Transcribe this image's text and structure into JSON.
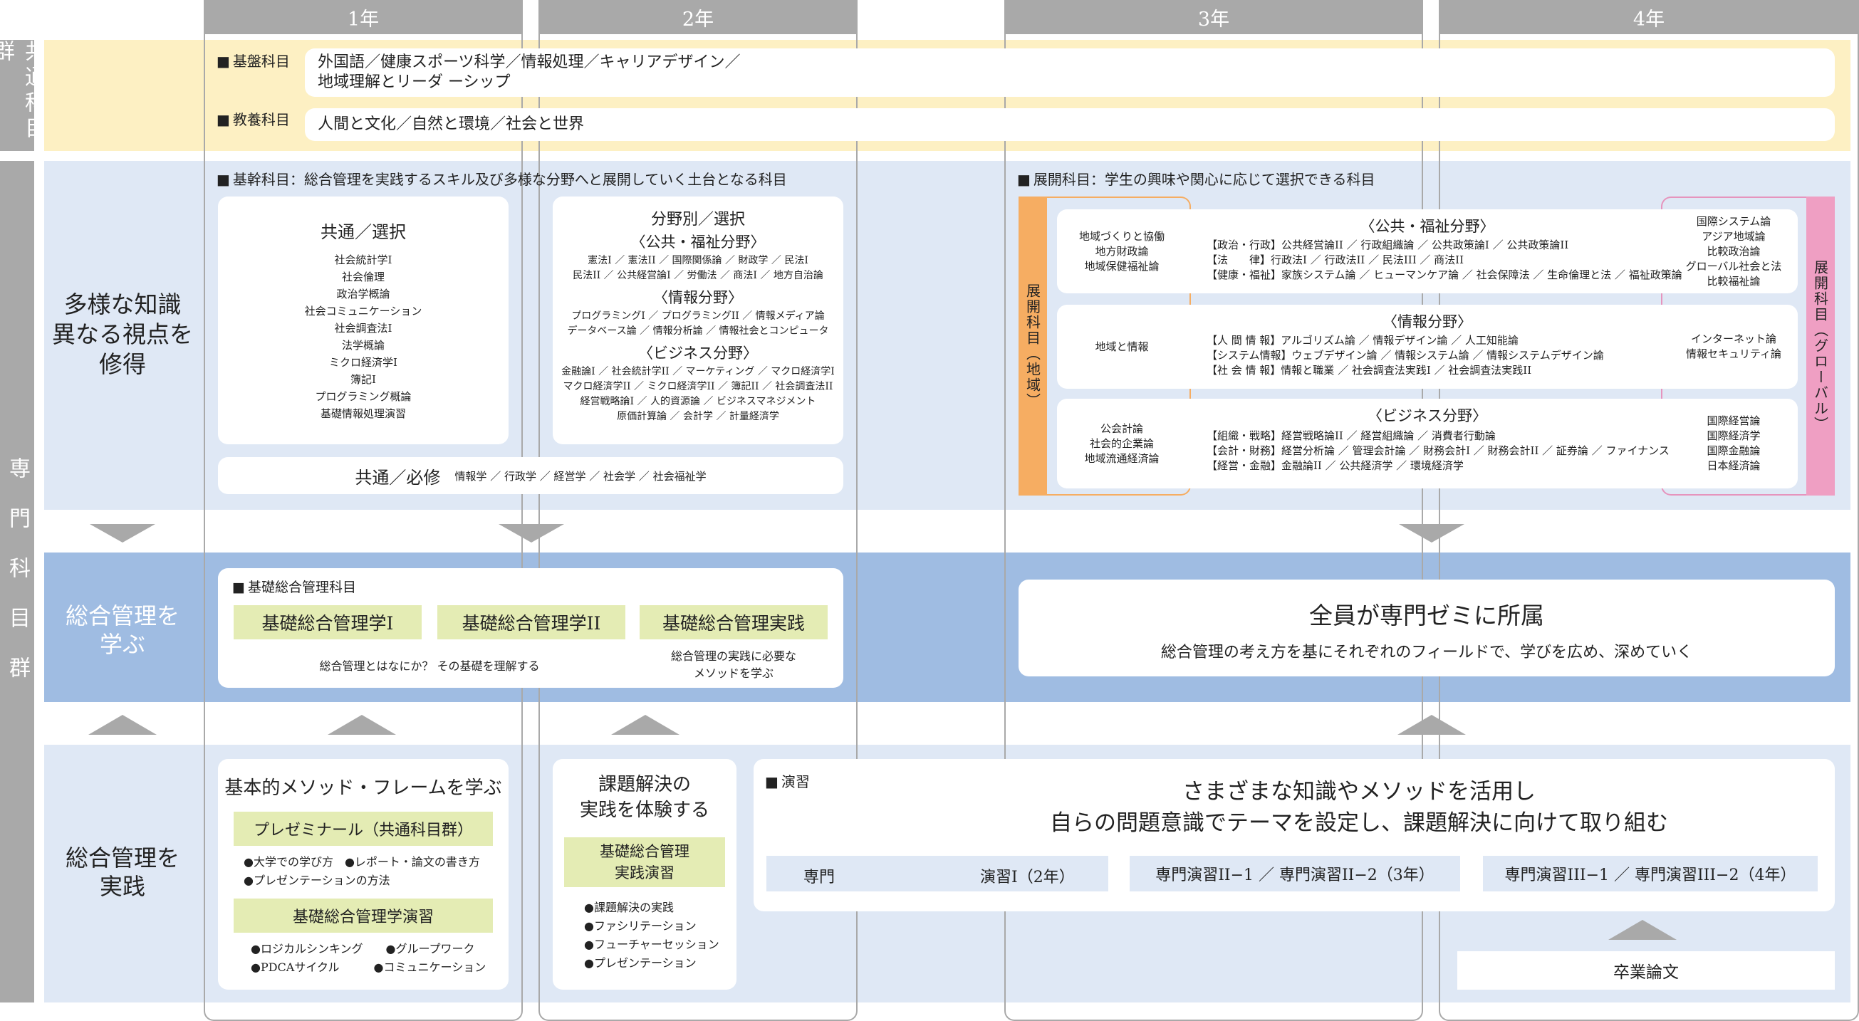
{
  "years": [
    "1年",
    "2年",
    "3年",
    "4年"
  ],
  "common_group": {
    "side_label": "共通科目群",
    "kiban_label": "基盤科目",
    "kiban_text": "外国語／健康スポーツ科学／情報処理／キャリアデザイン／\n地域理解とリーダ ーシップ",
    "kyoyo_label": "教養科目",
    "kyoyo_text": "人間と文化／自然と環境／社会と世界"
  },
  "specialized_group": {
    "side_label": "専門科目群"
  },
  "row1": {
    "title": "多様な知識\n異なる視点を\n修得",
    "kikan_header": "基幹科目：総合管理を実践するスキル及び多様な分野へと展開していく土台となる科目",
    "common_select": {
      "title": "共通／選択",
      "items": "社会統計学I\n社会倫理\n政治学概論\n社会コミュニケーション\n社会調査法I\n法学概論\nミクロ経済学I\n簿記I\nプログラミング概論\n基礎情報処理演習"
    },
    "field_select": {
      "title": "分野別／選択",
      "public_title": "〈公共・福祉分野〉",
      "public_items": "憲法I ／ 憲法II ／ 国際関係論 ／ 財政学 ／ 民法I\n民法II ／ 公共経営論I ／ 労働法 ／ 商法I ／ 地方自治論",
      "info_title": "〈情報分野〉",
      "info_items": "プログラミングI ／ プログラミングII ／ 情報メディア論\nデータベース論 ／ 情報分析論 ／ 情報社会とコンピュータ",
      "biz_title": "〈ビジネス分野〉",
      "biz_items": "金融論I ／ 社会統計学II ／ マーケティング ／ マクロ経済学I\nマクロ経済学II ／ ミクロ経済学II ／ 簿記II ／ 社会調査法II\n経営戦略論I ／ 人的資源論 ／ ビジネスマネジメント\n原価計算論 ／ 会計学 ／ 計量経済学"
    },
    "common_required": {
      "title": "共通／必修",
      "items": "情報学 ／ 行政学 ／ 経営学 ／ 社会学 ／ 社会福祉学"
    },
    "tenkai_header": "展開科目：学生の興味や関心に応じて選択できる科目",
    "regional_label": "展開科目（地域）",
    "global_label": "展開科目（グローバル）",
    "regional_items": [
      "地域づくりと協働\n地方財政論\n地域保健福祉論",
      "地域と情報",
      "公会計論\n社会的企業論\n地域流通経済論"
    ],
    "global_items": [
      "国際システム論\nアジア地域論\n比較政治論\nグローバル社会と法\n比較福祉論",
      "インターネット論\n情報セキュリティ論",
      "国際経営論\n国際経済学\n国際金融論\n日本経済論"
    ],
    "fields": [
      {
        "title": "〈公共・福祉分野〉",
        "rows": "【政治・行政】公共経営論II ／ 行政組織論 ／ 公共政策論I ／ 公共政策論II\n【法　　律】行政法I ／ 行政法II ／ 民法III ／ 商法II\n【健康・福祉】家族システム論 ／ ヒューマンケア論 ／ 社会保障法 ／ 生命倫理と法 ／ 福祉政策論"
      },
      {
        "title": "〈情報分野〉",
        "rows": "【人 間 情 報】アルゴリズム論 ／ 情報デザイン論 ／ 人工知能論\n【システム情報】ウェブデザイン論 ／ 情報システム論 ／ 情報システムデザイン論\n【社 会 情 報】情報と職業 ／ 社会調査法実践I ／ 社会調査法実践II"
      },
      {
        "title": "〈ビジネス分野〉",
        "rows": "【組織・戦略】経営戦略論II ／ 経営組織論 ／ 消費者行動論\n【会計・財務】経営分析論 ／ 管理会計論 ／ 財務会計I ／ 財務会計II ／ 証券論 ／ ファイナンス\n【経営・金融】金融論II ／ 公共経済学 ／ 環境経済学"
      }
    ]
  },
  "row2": {
    "title": "総合管理を\n学ぶ",
    "header": "基礎総合管理科目",
    "course1": "基礎総合管理学I",
    "course2": "基礎総合管理学II",
    "course3": "基礎総合管理実践",
    "desc1": "総合管理とはなにか？ その基礎を理解する",
    "desc2": "総合管理の実践に必要な\nメソッドを学ぶ",
    "seminar_title": "全員が専門ゼミに所属",
    "seminar_sub": "総合管理の考え方を基にそれぞれのフィールドで、学びを広め、深めていく"
  },
  "row3": {
    "title": "総合管理を\n実践",
    "box1_title": "基本的メソッド・フレームを学ぶ",
    "prezemi": "プレゼミナール（共通科目群）",
    "prezemi_items": "●大学での学び方　●レポート・論文の書き方\n●プレゼンテーションの方法",
    "kiso_enshu": "基礎総合管理学演習",
    "kiso_enshu_items": "●ロジカルシンキング　　●グループワーク\n●PDCAサイクル　　　●コミュニケーション",
    "box2_title": "課題解決の\n実践を体験する",
    "box2_course": "基礎総合管理\n実践演習",
    "box2_items": "●課題解決の実践\n●ファシリテーション\n●フューチャーセッション\n●プレゼンテーション",
    "enshu_label": "演習",
    "enshu_title": "さまざまな知識やメソッドを活用し\n自らの問題意識でテーマを設定し、課題解決に向けて取り組む",
    "enshu1_a": "専門",
    "enshu1_b": "演習I（2年）",
    "enshu2": "専門演習II−1 ／ 専門演習II−2（3年）",
    "enshu3": "専門演習III−1 ／ 専門演習III−2（4年）",
    "thesis": "卒業論文"
  }
}
